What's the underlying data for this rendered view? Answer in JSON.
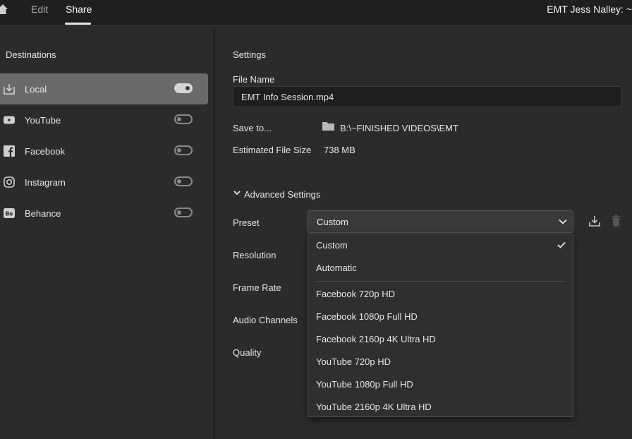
{
  "topbar": {
    "tabs": [
      {
        "label": "Edit"
      },
      {
        "label": "Share"
      }
    ],
    "user": "EMT Jess Nalley: ~"
  },
  "destinations": {
    "heading": "Destinations",
    "items": [
      {
        "label": "Local",
        "icon": "download-icon",
        "enabled": true
      },
      {
        "label": "YouTube",
        "icon": "youtube-icon",
        "enabled": false
      },
      {
        "label": "Facebook",
        "icon": "facebook-icon",
        "enabled": false
      },
      {
        "label": "Instagram",
        "icon": "instagram-icon",
        "enabled": false
      },
      {
        "label": "Behance",
        "icon": "behance-icon",
        "enabled": false
      }
    ]
  },
  "settings": {
    "heading": "Settings",
    "file_name_label": "File Name",
    "file_name_value": "EMT Info Session.mp4",
    "save_to_label": "Save to...",
    "save_to_path": "B:\\~FINISHED VIDEOS\\EMT",
    "estimated_size_label": "Estimated File Size",
    "estimated_size_value": "738 MB",
    "advanced_label": "Advanced Settings",
    "preset_label": "Preset",
    "preset_value": "Custom",
    "resolution_label": "Resolution",
    "frame_rate_label": "Frame Rate",
    "audio_channels_label": "Audio Channels",
    "quality_label": "Quality"
  },
  "preset_options": [
    "Custom",
    "Automatic",
    "Facebook 720p HD",
    "Facebook 1080p Full HD",
    "Facebook 2160p 4K Ultra HD",
    "YouTube 720p HD",
    "YouTube 1080p Full HD",
    "YouTube 2160p 4K Ultra HD"
  ],
  "colors": {
    "background": "#2b2b2b",
    "topbar": "#1f1f1f",
    "selected_row": "#6a6a6a",
    "input_bg": "#1e1e1e"
  }
}
